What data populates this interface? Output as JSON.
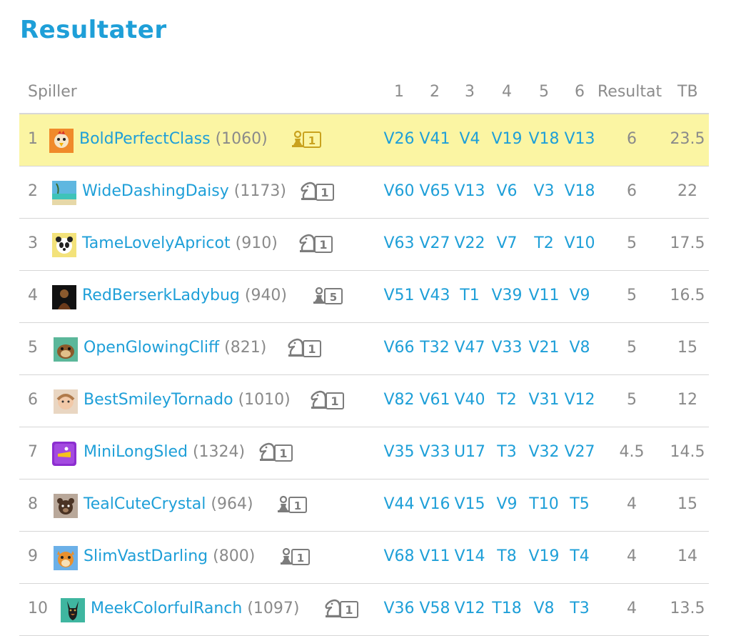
{
  "title": "Resultater",
  "header": {
    "player": "Spiller",
    "rounds": [
      "1",
      "2",
      "3",
      "4",
      "5",
      "6"
    ],
    "result": "Resultat",
    "tb": "TB"
  },
  "colors": {
    "accent": "#1e9fd8",
    "highlight": "#fbf5a3",
    "muted": "#8a8a8a"
  },
  "rows": [
    {
      "rank": "1",
      "name": "BoldPerfectClass",
      "rating": "(1060)",
      "badge_icon": "pawn-badge-icon",
      "badge_num": "1",
      "badge_color": "#c9a21e",
      "avatar": "rooster-avatar",
      "games": [
        "V26",
        "V41",
        "V4",
        "V19",
        "V18",
        "V13"
      ],
      "result": "6",
      "tb": "23.5",
      "highlight": true
    },
    {
      "rank": "2",
      "name": "WideDashingDaisy",
      "rating": "(1173)",
      "badge_icon": "knight-badge-icon",
      "badge_num": "1",
      "badge_color": "#7c7c7c",
      "avatar": "beach-avatar",
      "games": [
        "V60",
        "V65",
        "V13",
        "V6",
        "V3",
        "V18"
      ],
      "result": "6",
      "tb": "22"
    },
    {
      "rank": "3",
      "name": "TameLovelyApricot",
      "rating": "(910)",
      "badge_icon": "knight-badge-icon",
      "badge_num": "1",
      "badge_color": "#7c7c7c",
      "avatar": "panda-avatar",
      "games": [
        "V63",
        "V27",
        "V22",
        "V7",
        "T2",
        "V10"
      ],
      "result": "5",
      "tb": "17.5"
    },
    {
      "rank": "4",
      "name": "RedBerserkLadybug",
      "rating": "(940)",
      "badge_icon": "pawn-badge-icon",
      "badge_num": "5",
      "badge_color": "#7c7c7c",
      "avatar": "photo-avatar",
      "games": [
        "V51",
        "V43",
        "T1",
        "V39",
        "V11",
        "V9"
      ],
      "result": "5",
      "tb": "16.5"
    },
    {
      "rank": "5",
      "name": "OpenGlowingCliff",
      "rating": "(821)",
      "badge_icon": "knight-badge-icon",
      "badge_num": "1",
      "badge_color": "#7c7c7c",
      "avatar": "hamster-avatar",
      "games": [
        "V66",
        "T32",
        "V47",
        "V33",
        "V21",
        "V8"
      ],
      "result": "5",
      "tb": "15"
    },
    {
      "rank": "6",
      "name": "BestSmileyTornado",
      "rating": "(1010)",
      "badge_icon": "knight-badge-icon",
      "badge_num": "1",
      "badge_color": "#7c7c7c",
      "avatar": "child-avatar",
      "games": [
        "V82",
        "V61",
        "V40",
        "T2",
        "V31",
        "V12"
      ],
      "result": "5",
      "tb": "12"
    },
    {
      "rank": "7",
      "name": "MiniLongSled",
      "rating": "(1324)",
      "badge_icon": "knight-badge-icon",
      "badge_num": "1",
      "badge_color": "#7c7c7c",
      "avatar": "purple-bird-avatar",
      "games": [
        "V35",
        "V33",
        "U17",
        "T3",
        "V32",
        "V27"
      ],
      "result": "4.5",
      "tb": "14.5"
    },
    {
      "rank": "8",
      "name": "TealCuteCrystal",
      "rating": "(964)",
      "badge_icon": "pawn-badge-icon",
      "badge_num": "1",
      "badge_color": "#7c7c7c",
      "avatar": "bear-avatar",
      "games": [
        "V44",
        "V16",
        "V15",
        "V9",
        "T10",
        "T5"
      ],
      "result": "4",
      "tb": "15"
    },
    {
      "rank": "9",
      "name": "SlimVastDarling",
      "rating": "(800)",
      "badge_icon": "pawn-badge-icon",
      "badge_num": "1",
      "badge_color": "#7c7c7c",
      "avatar": "squirrel-avatar",
      "games": [
        "V68",
        "V11",
        "V14",
        "T8",
        "V19",
        "T4"
      ],
      "result": "4",
      "tb": "14"
    },
    {
      "rank": "10",
      "name": "MeekColorfulRanch",
      "rating": "(1097)",
      "badge_icon": "knight-badge-icon",
      "badge_num": "1",
      "badge_color": "#7c7c7c",
      "avatar": "dog-avatar",
      "games": [
        "V36",
        "V58",
        "V12",
        "T18",
        "V8",
        "T3"
      ],
      "result": "4",
      "tb": "13.5"
    }
  ]
}
